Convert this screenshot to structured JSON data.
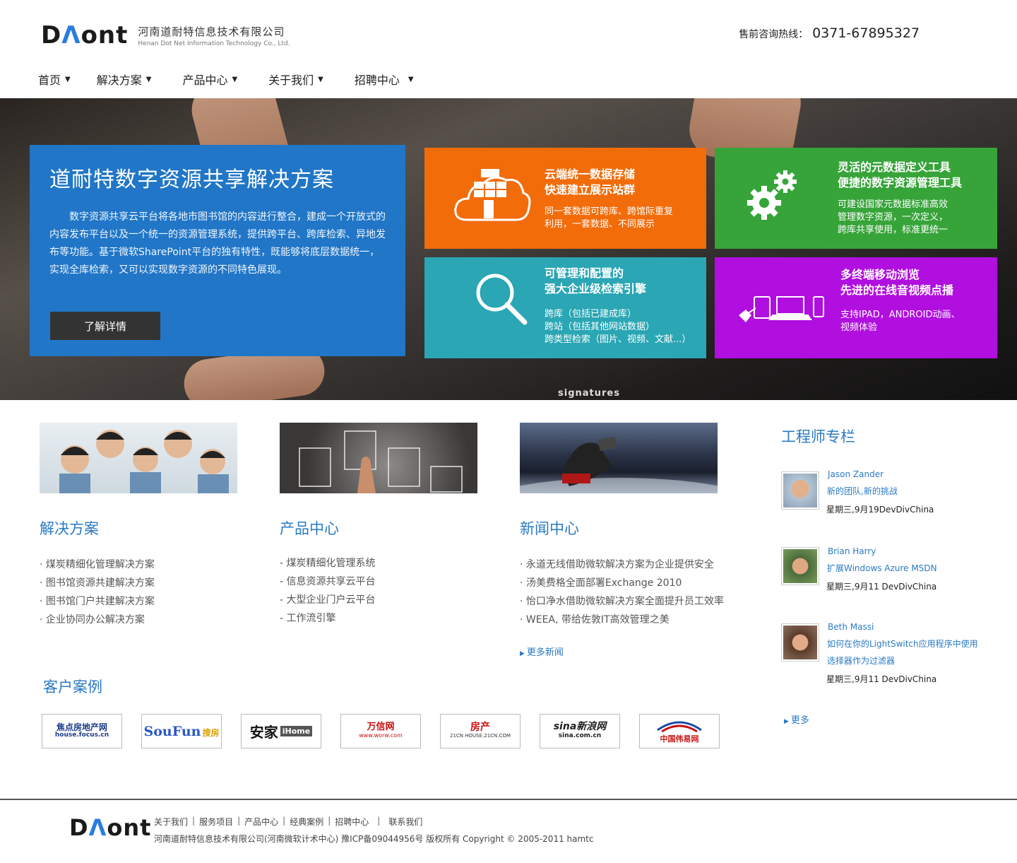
{
  "header": {
    "logo_mark_1": "D",
    "logo_mark_a": "Λ",
    "logo_mark_2": "ont",
    "company_cn": "河南道耐特信息技术有限公司",
    "company_en": "Henan Dot Net Information Technology Co., Ltd.",
    "hotline_label": "售前咨询热线：",
    "hotline_number": "0371-67895327"
  },
  "nav": [
    {
      "label": "首页"
    },
    {
      "label": "解决方案"
    },
    {
      "label": "产品中心"
    },
    {
      "label": "关于我们"
    },
    {
      "label": "招聘中心"
    }
  ],
  "banner": {
    "intro_title": "道耐特数字资源共享解决方案",
    "intro_text": "数字资源共享云平台将各地市图书馆的内容进行整合，建成一个开放式的内容发布平台以及一个统一的资源管理系统，提供跨平台、跨库检索、异地发布等功能。基于微软SharePoint平台的独有特性，既能够将底层数据统一，实现全库检索，又可以实现数字资源的不同特色展现。",
    "intro_button": "了解详情",
    "sign_text": "signatures",
    "tiles": [
      {
        "title_1": "云端统一数据存储",
        "title_2": "快速建立展示站群",
        "desc_1": "同一套数据可跨库、跨馆际重复",
        "desc_2": "利用，一套数据、不同展示",
        "desc_3": "",
        "color": "#f26c0a"
      },
      {
        "title_1": "灵活的元数据定义工具",
        "title_2": "便捷的数字资源管理工具",
        "desc_1": "可建设国家元数据标准高效",
        "desc_2": "管理数字资源，一次定义，",
        "desc_3": "跨库共享使用，标准更统一",
        "color": "#37a43a"
      },
      {
        "title_1": "可管理和配置的",
        "title_2": "强大企业级检索引擎",
        "desc_1": "跨库（包括已建成库）",
        "desc_2": "跨站（包括其他网站数据）",
        "desc_3": "跨类型检索（图片、视频、文献...）",
        "color": "#2aa6b4"
      },
      {
        "title_1": "多终端移动浏览",
        "title_2": "先进的在线音视频点播",
        "desc_1": "支持IPAD，ANDROID动画、",
        "desc_2": "视频体验",
        "desc_3": "",
        "color": "#b10ee0"
      }
    ]
  },
  "solutions": {
    "title": "解决方案",
    "items": [
      "· 煤炭精细化管理解决方案",
      "· 图书馆资源共建解决方案",
      "· 图书馆门户共建解决方案",
      "· 企业协同办公解决方案"
    ]
  },
  "products": {
    "title": "产品中心",
    "items": [
      "- 煤炭精细化管理系统",
      "- 信息资源共享云平台",
      "- 大型企业门户云平台",
      "- 工作流引擎"
    ]
  },
  "news": {
    "title": "新闻中心",
    "items": [
      "· 永道无线借助微软解决方案为企业提供安全",
      "· 汤美费格全面部署Exchange 2010",
      "· 怡口净水借助微软解决方案全面提升员工效率",
      "· WEEA, 带给佐敦IT高效管理之美"
    ],
    "more": "更多新闻"
  },
  "engineers": {
    "title": "工程师专栏",
    "items": [
      {
        "name": "Jason Zander",
        "article_1": "新的团队,新的挑战",
        "article_2": "",
        "date": "星期三,9月19DevDivChina"
      },
      {
        "name": "Brian Harry",
        "article_1": "扩展Windows Azure MSDN",
        "article_2": "",
        "date": "星期三,9月11 DevDivChina"
      },
      {
        "name": "Beth Massi",
        "article_1": "如何在你的LightSwitch应用程序中使用",
        "article_2": "选择器作为过滤器",
        "date": "星期三,9月11 DevDivChina"
      }
    ],
    "more": "更多"
  },
  "cases": {
    "title": "客户案例",
    "logos": [
      {
        "name": "焦点房地产网",
        "sub": "house.focus.cn",
        "color": "#1a3a8a"
      },
      {
        "name": "SouFun",
        "sub": "搜房",
        "color": "#2a58c4"
      },
      {
        "name": "安家",
        "sub": "iHome",
        "color": "#111111"
      },
      {
        "name": "万信网",
        "sub": "www.worw.com",
        "color": "#c81010"
      },
      {
        "name": "房产",
        "sub": "21CN HOUSE.21CN.COM",
        "color": "#c81010"
      },
      {
        "name": "sina新浪网",
        "sub": "sina.com.cn",
        "color": "#222222"
      },
      {
        "name": "中国伟易网",
        "sub": "",
        "color": "#c81010"
      }
    ]
  },
  "footer": {
    "links": [
      "关于我们",
      "服务项目",
      "产品中心",
      "经典案例",
      "招聘中心",
      "联系我们"
    ],
    "copyright": "河南道耐特信息技术有限公司(河南微软计术中心) 豫ICP备09044956号  版权所有 Copyright © 2005-2011 hamtc"
  },
  "colors": {
    "accent": "#2a7ac5",
    "intro_bg": "#2176c7",
    "tile_orange": "#f26c0a",
    "tile_green": "#37a43a",
    "tile_teal": "#2aa6b4",
    "tile_purple": "#b10ee0"
  }
}
